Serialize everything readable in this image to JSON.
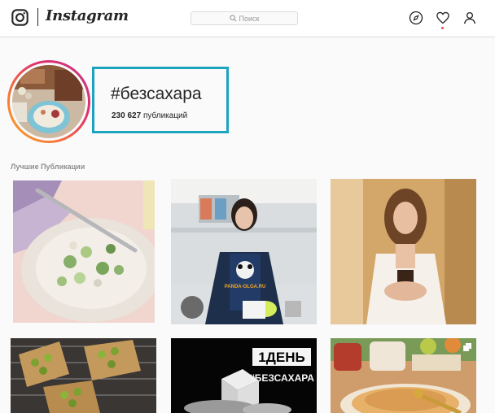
{
  "nav": {
    "logo_glyph": "instagram-camera-icon",
    "wordmark": "Instagram",
    "search_placeholder": "Поиск",
    "icons": [
      "explore-compass-icon",
      "heart-icon",
      "profile-icon"
    ],
    "notification_dot_color": "#ed4956"
  },
  "header": {
    "hashtag": "#безсахара",
    "posts_count": "230 627",
    "posts_label": "публикаций",
    "highlight_color": "#1aa4c0"
  },
  "section": {
    "top_posts_label": "Лучшие Публикации"
  },
  "posts": [
    {
      "description": "salad plate with fork"
    },
    {
      "description": "woman in panda apron in kitchen",
      "apron_text": "PANDA-OLGA.RU"
    },
    {
      "description": "woman holding cup"
    },
    {
      "description": "pastries on cooling rack"
    },
    {
      "description": "sugar cubes promo",
      "overlay_line1": "1ДЕНЬ",
      "overlay_line2": "#БЕЗСАХАРА"
    },
    {
      "description": "pancakes with honey and jars"
    }
  ]
}
